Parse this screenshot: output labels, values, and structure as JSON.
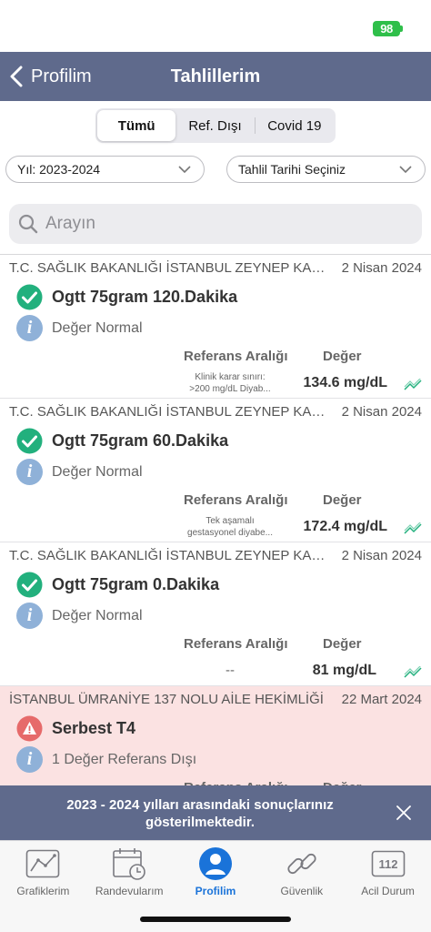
{
  "status": {
    "battery": "98"
  },
  "nav": {
    "back_label": "Profilim",
    "title": "Tahlillerim"
  },
  "segments": [
    "Tümü",
    "Ref. Dışı",
    "Covid 19"
  ],
  "filters": {
    "year": "Yıl: 2023-2024",
    "date": "Tahlil Tarihi Seçiniz"
  },
  "search": {
    "placeholder": "Arayın"
  },
  "columns": {
    "ref": "Referans Aralığı",
    "value": "Değer"
  },
  "results": [
    {
      "institution": "T.C. SAĞLIK BAKANLIĞI İSTANBUL ZEYNEP KAMİL",
      "date": "2 Nisan 2024",
      "title": "Ogtt 75gram 120.Dakika",
      "status": "Değer Normal",
      "ref_line1": "Klinik karar sınırı:",
      "ref_line2": ">200 mg/dL   Diyab...",
      "value": "134.6 mg/dL",
      "state": "normal"
    },
    {
      "institution": "T.C. SAĞLIK BAKANLIĞI İSTANBUL ZEYNEP KAMİL",
      "date": "2 Nisan 2024",
      "title": "Ogtt 75gram 60.Dakika",
      "status": "Değer Normal",
      "ref_line1": "Tek aşamalı",
      "ref_line2": "gestasyonel diyabe...",
      "value": "172.4 mg/dL",
      "state": "normal"
    },
    {
      "institution": "T.C. SAĞLIK BAKANLIĞI İSTANBUL ZEYNEP KAMİL",
      "date": "2 Nisan 2024",
      "title": "Ogtt 75gram 0.Dakika",
      "status": "Değer Normal",
      "ref_line1": "--",
      "ref_line2": "",
      "value": "81 mg/dL",
      "state": "normal"
    },
    {
      "institution": "İSTANBUL ÜMRANİYE 137 NOLU AİLE HEKİMLİĞİ",
      "date": "22 Mart 2024",
      "title": "Serbest T4",
      "status": "1 Değer Referans Dışı",
      "ref_line1": "",
      "ref_line2": "",
      "value": "",
      "state": "alert"
    }
  ],
  "toast": {
    "message": "2023 - 2024 yılları arasındaki sonuçlarınız gösterilmektedir."
  },
  "tabs": [
    {
      "label": "Grafiklerim",
      "icon": "chart-icon"
    },
    {
      "label": "Randevularım",
      "icon": "calendar-icon"
    },
    {
      "label": "Profilim",
      "icon": "profile-icon"
    },
    {
      "label": "Güvenlik",
      "icon": "link-icon"
    },
    {
      "label": "Acil Durum",
      "icon": "emergency-112-icon",
      "badge": "112"
    }
  ],
  "colors": {
    "nav": "#5f6a8c",
    "check": "#22b07d",
    "alert": "#e66a6a",
    "alert_bg": "#fbe2e2",
    "active_tab": "#1a73d9"
  }
}
